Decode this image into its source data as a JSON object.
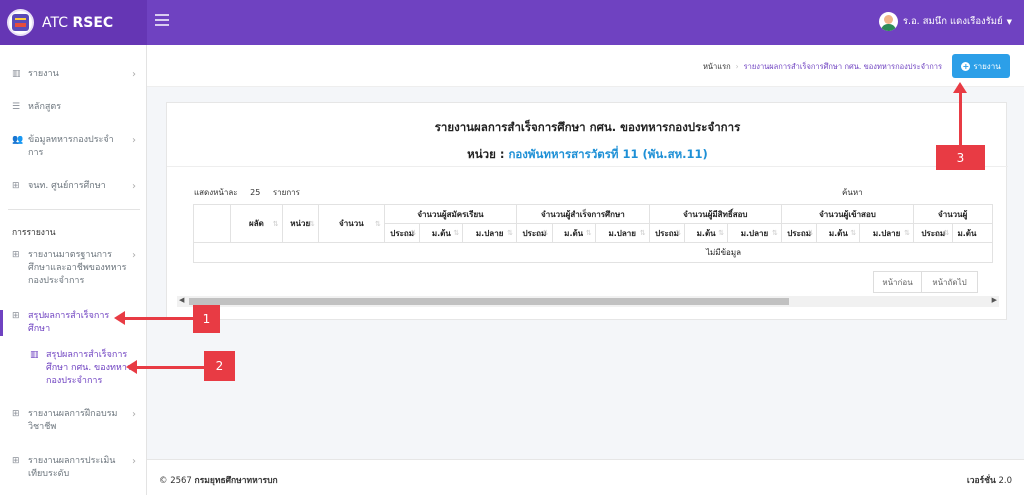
{
  "app": {
    "brand_prefix": "ATC",
    "brand_strong": "RSEC",
    "user_name": "ร.อ. สมนึก แดงเรืองรัมย์"
  },
  "sidebar": {
    "items": [
      {
        "label": "รายงาน"
      },
      {
        "label": "หลักสูตร"
      },
      {
        "label": "ข้อมูลทหารกองประจำการ"
      },
      {
        "label": "จนท. ศูนย์การศึกษา"
      }
    ],
    "section_title": "การรายงาน",
    "report_items": [
      {
        "label": "รายงานมาตรฐานการศึกษาและอาชีพของทหารกองประจำการ"
      },
      {
        "label": "สรุปผลการสำเร็จการศึกษา"
      },
      {
        "label": "สรุปผลการสำเร็จการศึกษา กศน. ของทหารกองประจำการ"
      },
      {
        "label": "รายงานผลการฝึกอบรมวิชาชีพ"
      },
      {
        "label": "รายงานผลการประเมินเทียบระดับ"
      }
    ]
  },
  "breadcrumb": {
    "home": "หน้าแรก",
    "current": "รายงานผลการสำเร็จการศึกษา กศน. ของทหารกองประจำการ"
  },
  "toolbar": {
    "report_button": "รายงาน"
  },
  "report": {
    "title": "รายงานผลการสำเร็จการศึกษา กศน. ของทหารกองประจำการ",
    "unit_label": "หน่วย :",
    "unit_value": "กองพันทหารสารวัตรที่ 11 (พัน.สห.11)",
    "show_label": "แสดงหน้าละ",
    "page_size": "25",
    "items_label": "รายการ",
    "search_label": "ค้นหา",
    "columns": {
      "batch": "ผลัด",
      "unit": "หน่วย",
      "count": "จำนวน",
      "groups": [
        "จำนวนผู้สมัครเรียน",
        "จำนวนผู้สำเร็จการศึกษา",
        "จำนวนผู้มีสิทธิ์สอบ",
        "จำนวนผู้เข้าสอบ",
        "จำนวนผู้"
      ],
      "levels": [
        "ประถม",
        "ม.ต้น",
        "ม.ปลาย"
      ]
    },
    "empty": "ไม่มีข้อมูล",
    "prev": "หน้าก่อน",
    "next": "หน้าถัดไป"
  },
  "footer": {
    "year": "© 2567",
    "org": "กรมยุทธศึกษาทหารบก",
    "version_label": "เวอร์ชั่น",
    "version": "2.0"
  },
  "annotations": [
    "1",
    "2",
    "3"
  ],
  "colors": {
    "primary": "#6f42c1",
    "accent": "#2c9fe8",
    "annotation": "#e83b44"
  }
}
